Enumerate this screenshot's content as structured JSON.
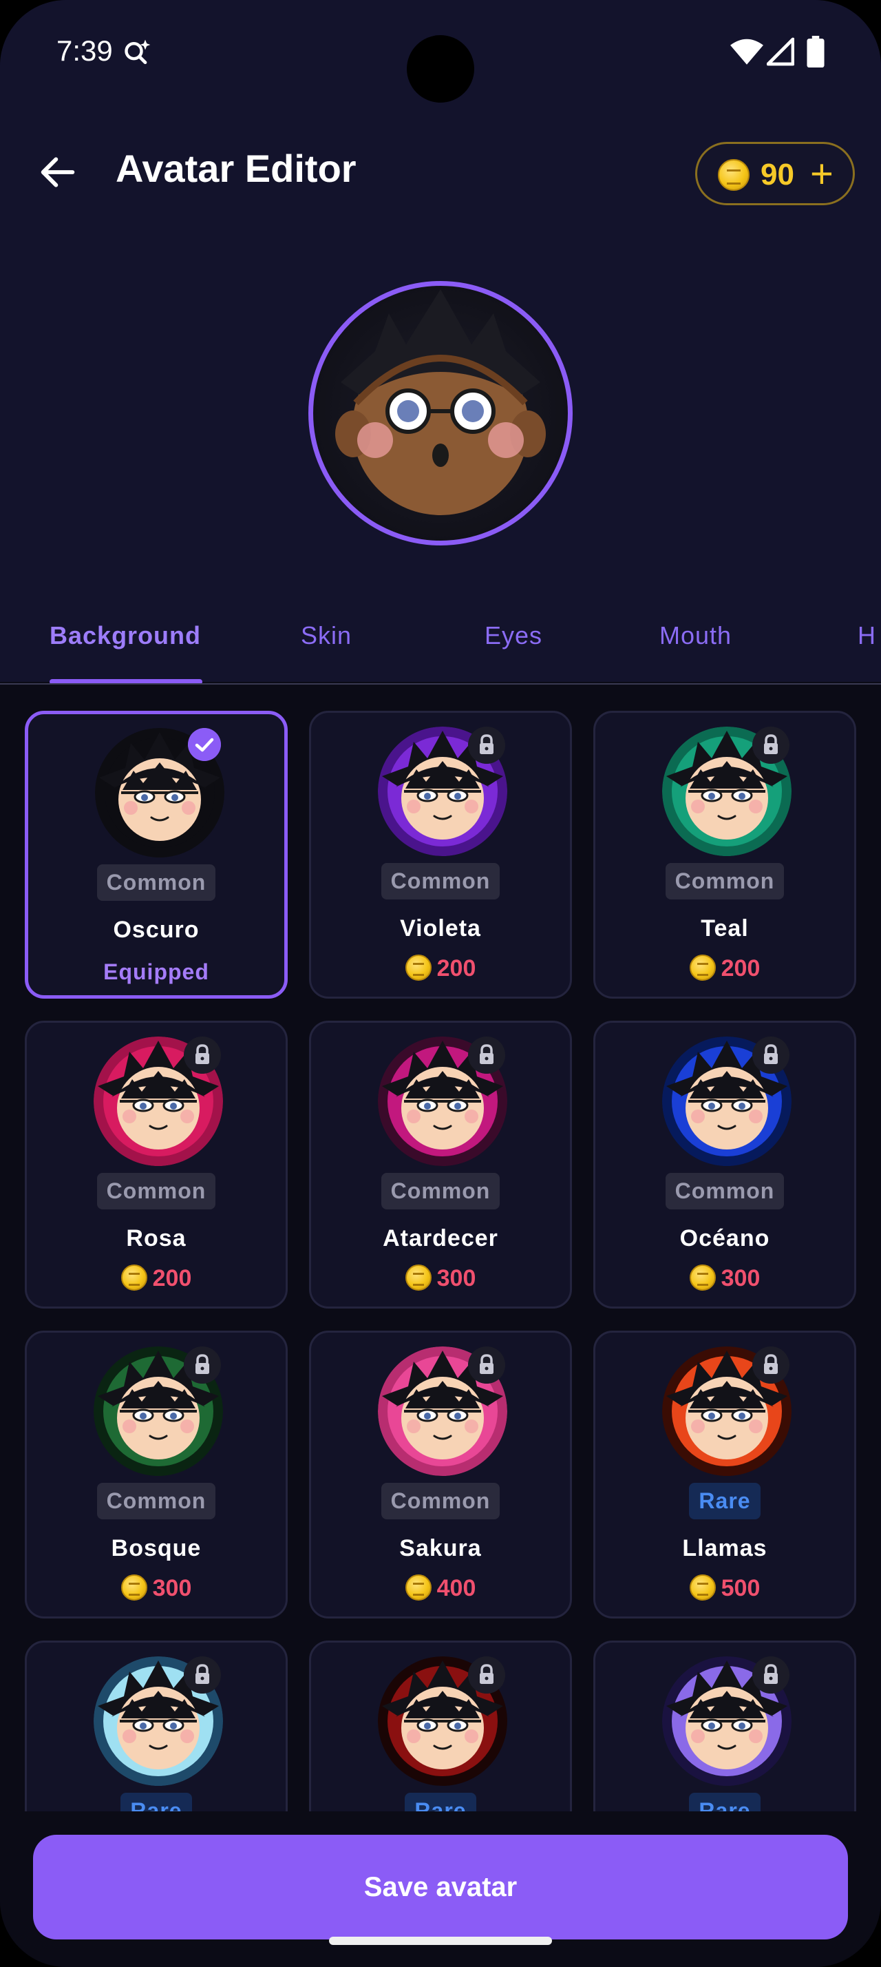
{
  "status_bar": {
    "time": "7:39",
    "icons": [
      "assistant-search-icon",
      "wifi-icon",
      "cellular-signal-icon",
      "battery-icon"
    ]
  },
  "header": {
    "title": "Avatar Editor",
    "back_icon": "arrow-left-icon",
    "coins": "90",
    "add_coins_label": "+"
  },
  "tabs": [
    {
      "label": "Background",
      "active": true
    },
    {
      "label": "Skin",
      "active": false
    },
    {
      "label": "Eyes",
      "active": false
    },
    {
      "label": "Mouth",
      "active": false
    },
    {
      "label": "H",
      "active": false
    }
  ],
  "items": [
    {
      "name": "Oscuro",
      "rarity": "Common",
      "status": "Equipped",
      "price": "",
      "bg": "#0d0d12",
      "glow": "#0d0d12",
      "locked": false,
      "selected": true
    },
    {
      "name": "Violeta",
      "rarity": "Common",
      "status": "",
      "price": "200",
      "bg": "#7b2ad6",
      "glow": "#4a148c",
      "locked": true,
      "selected": false
    },
    {
      "name": "Teal",
      "rarity": "Common",
      "status": "",
      "price": "200",
      "bg": "#15a07a",
      "glow": "#0b6b52",
      "locked": true,
      "selected": false
    },
    {
      "name": "Rosa",
      "rarity": "Common",
      "status": "",
      "price": "200",
      "bg": "#d81b60",
      "glow": "#a3124a",
      "locked": true,
      "selected": false
    },
    {
      "name": "Atardecer",
      "rarity": "Common",
      "status": "",
      "price": "300",
      "bg": "#c2187e",
      "glow": "#3a0a2a",
      "locked": true,
      "selected": false
    },
    {
      "name": "Océano",
      "rarity": "Common",
      "status": "",
      "price": "300",
      "bg": "#1a3fd6",
      "glow": "#061a5c",
      "locked": true,
      "selected": false
    },
    {
      "name": "Bosque",
      "rarity": "Common",
      "status": "",
      "price": "300",
      "bg": "#1e6a34",
      "glow": "#0a2412",
      "locked": true,
      "selected": false
    },
    {
      "name": "Sakura",
      "rarity": "Common",
      "status": "",
      "price": "400",
      "bg": "#e94796",
      "glow": "#b82d70",
      "locked": true,
      "selected": false
    },
    {
      "name": "Llamas",
      "rarity": "Rare",
      "status": "",
      "price": "500",
      "bg": "#e8461a",
      "glow": "#3a0c04",
      "locked": true,
      "selected": false
    },
    {
      "name": "",
      "rarity": "Rare",
      "status": "",
      "price": "",
      "bg": "#9fe0f2",
      "glow": "#1e4a6a",
      "locked": true,
      "selected": false
    },
    {
      "name": "",
      "rarity": "Rare",
      "status": "",
      "price": "",
      "bg": "#8a1010",
      "glow": "#1a0505",
      "locked": true,
      "selected": false
    },
    {
      "name": "",
      "rarity": "Rare",
      "status": "",
      "price": "",
      "bg": "#8a6ae8",
      "glow": "#1a1240",
      "locked": true,
      "selected": false
    }
  ],
  "footer": {
    "save_label": "Save avatar"
  },
  "colors": {
    "accent": "#8b5cf6",
    "coin": "#f6c928",
    "price": "#f0506e",
    "rare": "#4a8cf2"
  }
}
